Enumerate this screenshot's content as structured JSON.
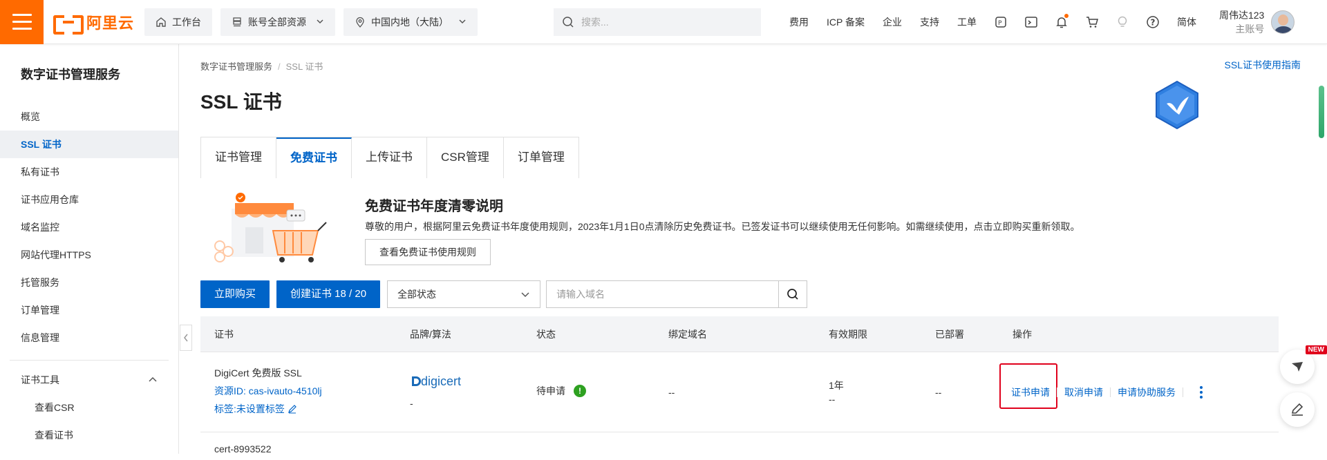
{
  "topbar": {
    "logo_text": "阿里云",
    "workbench": "工作台",
    "resources": "账号全部资源",
    "region": "中国内地（大陆）",
    "search_placeholder": "搜索...",
    "nav": [
      "费用",
      "ICP 备案",
      "企业",
      "支持",
      "工单"
    ],
    "lang": "简体",
    "user_name": "周伟达123",
    "user_role": "主账号"
  },
  "sidebar": {
    "title": "数字证书管理服务",
    "items": [
      {
        "label": "概览"
      },
      {
        "label": "SSL 证书"
      },
      {
        "label": "私有证书"
      },
      {
        "label": "证书应用仓库"
      },
      {
        "label": "域名监控"
      },
      {
        "label": "网站代理HTTPS"
      },
      {
        "label": "托管服务"
      },
      {
        "label": "订单管理"
      },
      {
        "label": "信息管理"
      }
    ],
    "group_label": "证书工具",
    "sub_items": [
      {
        "label": "查看CSR"
      },
      {
        "label": "查看证书"
      }
    ]
  },
  "breadcrumb": {
    "parent": "数字证书管理服务",
    "current": "SSL 证书"
  },
  "guide_link": "SSL证书使用指南",
  "page_title": "SSL 证书",
  "tabs": [
    {
      "label": "证书管理"
    },
    {
      "label": "免费证书"
    },
    {
      "label": "上传证书"
    },
    {
      "label": "CSR管理"
    },
    {
      "label": "订单管理"
    }
  ],
  "notice": {
    "title": "免费证书年度清零说明",
    "desc": "尊敬的用户，根据阿里云免费证书年度使用规则，2023年1月1日0点清除历史免费证书。已签发证书可以继续使用无任何影响。如需继续使用，点击立即购买重新领取。",
    "button": "查看免费证书使用规则"
  },
  "toolbar": {
    "buy": "立即购买",
    "create": "创建证书 18 / 20",
    "status_select": "全部状态",
    "domain_placeholder": "请输入域名"
  },
  "table": {
    "headers": [
      "证书",
      "品牌/算法",
      "状态",
      "绑定域名",
      "有效期限",
      "已部署",
      "操作"
    ],
    "rows": [
      {
        "name": "DigiCert 免费版 SSL",
        "resource_id": "资源ID: cas-ivauto-4510lj",
        "tag": "标签:未设置标签",
        "brand": "digicert",
        "algorithm": "-",
        "status": "待申请",
        "domain": "--",
        "validity": "1年",
        "validity_sub": "--",
        "deployed": "--",
        "ops": [
          "证书申请",
          "取消申请",
          "申请协助服务"
        ]
      },
      {
        "name": "cert-8993522"
      }
    ]
  },
  "float": {
    "new_badge": "NEW"
  },
  "colors": {
    "brand_orange": "#ff6a00",
    "primary_blue": "#0064c8",
    "highlight_red": "#e0001b",
    "status_green": "#2ea121"
  }
}
